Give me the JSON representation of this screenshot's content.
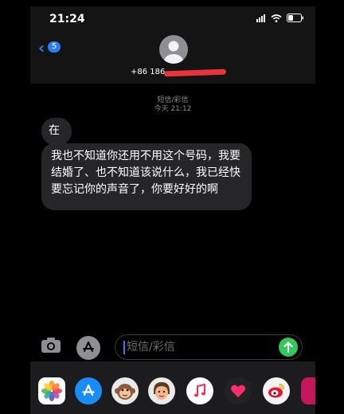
{
  "status_bar": {
    "time": "21:24"
  },
  "header": {
    "back_badge": "5",
    "contact_number": "+86 186"
  },
  "conversation": {
    "message_type": "短信/彩信",
    "timestamp": "今天 21:12",
    "messages": [
      {
        "text": "在"
      },
      {
        "text": "我也不知道你还用不用这个号码，我要结婚了、也不知道该说什么，我已经快要忘记你的声音了，你要好好的啊"
      }
    ]
  },
  "input": {
    "placeholder": "短信/彩信"
  },
  "app_drawer": {
    "apps": [
      {
        "icon": "photos-icon"
      },
      {
        "icon": "app-store-icon"
      },
      {
        "icon": "monkey-memoji-icon"
      },
      {
        "icon": "memoji-icon"
      },
      {
        "icon": "music-icon"
      },
      {
        "icon": "digital-touch-icon"
      },
      {
        "icon": "weibo-icon"
      }
    ]
  },
  "colors": {
    "accent_blue": "#2f7bf6",
    "send_green": "#34c759",
    "bubble_gray": "#262628"
  }
}
